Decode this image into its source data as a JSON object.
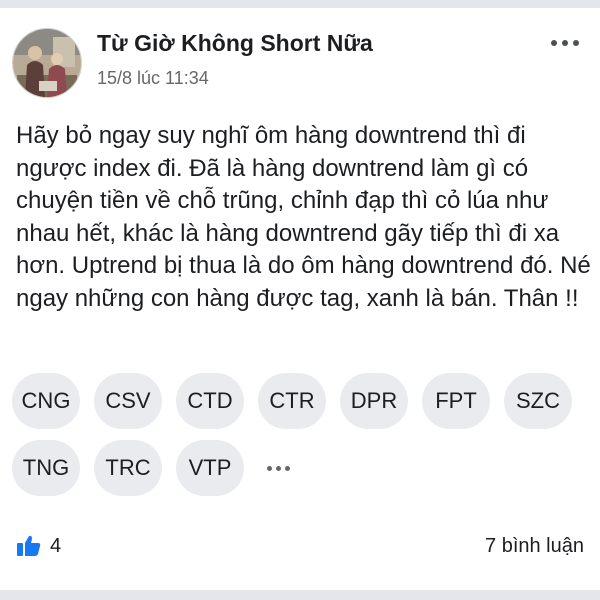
{
  "post": {
    "author_name": "Từ Giờ Không Short Nữa",
    "timestamp": "15/8 lúc 11:34",
    "text": "Hãy bỏ ngay suy nghĩ ôm hàng downtrend thì đi ngược index đi. Đã là hàng downtrend làm gì có chuyện tiền về chỗ trũng, chỉnh đạp thì cỏ lúa như nhau hết, khác là hàng downtrend gãy tiếp thì đi xa hơn. Uptrend bị thua là do ôm hàng downtrend đó. Né ngay những con hàng được tag, xanh là bán. Thân !!",
    "tags_row1": [
      "CNG",
      "CSV",
      "CTD",
      "CTR",
      "DPR",
      "FPT",
      "SZC"
    ],
    "tags_row2": [
      "TNG",
      "TRC",
      "VTP"
    ],
    "more_icon": "more-dots-icon",
    "like_icon": "thumbs-up-icon",
    "like_count": "4",
    "comments_label": "7 bình luận"
  },
  "colors": {
    "like_blue": "#1877f2",
    "tag_bg": "#eaebee",
    "secondary_text": "#65676b"
  }
}
